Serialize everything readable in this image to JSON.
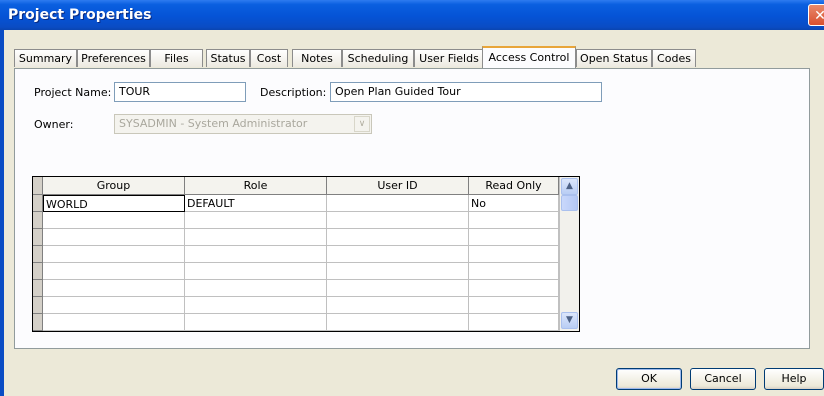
{
  "window": {
    "title": "Project Properties",
    "close_glyph": "✕"
  },
  "tabs": [
    {
      "label": "Summary"
    },
    {
      "label": "Preferences"
    },
    {
      "label": "Files"
    },
    {
      "label": "Status"
    },
    {
      "label": "Cost"
    },
    {
      "label": "Notes"
    },
    {
      "label": "Scheduling"
    },
    {
      "label": "User Fields"
    },
    {
      "label": "Access Control",
      "active": true
    },
    {
      "label": "Open Status"
    },
    {
      "label": "Codes"
    }
  ],
  "form": {
    "project_name_label": "Project Name:",
    "project_name_value": "TOUR",
    "description_label": "Description:",
    "description_value": "Open Plan Guided Tour",
    "owner_label": "Owner:",
    "owner_value": "SYSADMIN - System Administrator"
  },
  "grid": {
    "columns": [
      "Group",
      "Role",
      "User ID",
      "Read Only"
    ],
    "rows": [
      [
        "WORLD",
        "DEFAULT",
        "",
        "No"
      ],
      [
        "",
        "",
        "",
        ""
      ],
      [
        "",
        "",
        "",
        ""
      ],
      [
        "",
        "",
        "",
        ""
      ],
      [
        "",
        "",
        "",
        ""
      ],
      [
        "",
        "",
        "",
        ""
      ],
      [
        "",
        "",
        "",
        ""
      ],
      [
        "",
        "",
        "",
        ""
      ]
    ],
    "scroll_up": "▲",
    "scroll_down": "▼"
  },
  "buttons": {
    "ok": "OK",
    "cancel": "Cancel",
    "help": "Help"
  },
  "icons": {
    "combo_arrow": "chevron-down-icon",
    "close": "close-icon"
  }
}
